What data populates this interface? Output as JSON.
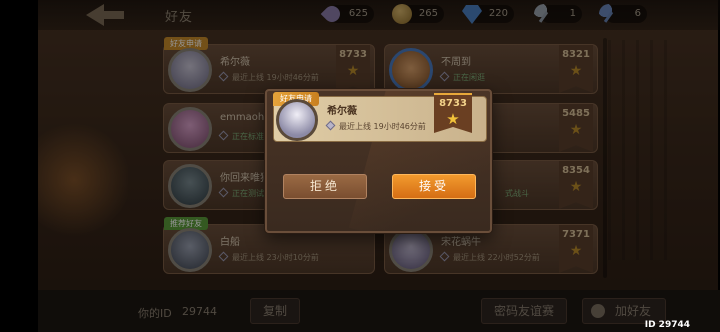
{
  "header": {
    "title": "好友",
    "resources": [
      {
        "icon": "feather-icon",
        "value": "625"
      },
      {
        "icon": "coin-icon",
        "value": "265"
      },
      {
        "icon": "gem-icon",
        "value": "220"
      },
      {
        "icon": "silver-key-icon",
        "value": "1"
      },
      {
        "icon": "blue-key-icon",
        "value": "6"
      }
    ]
  },
  "friends": [
    {
      "name": "希尔薇",
      "status": "最近上线 19小时46分前",
      "score": "8733",
      "tag": "好友申请"
    },
    {
      "name": "emmaoh",
      "status": "正在标准",
      "score": ""
    },
    {
      "name": "你回来唯猎",
      "status": "正在测试",
      "score": ""
    },
    {
      "name": "白船",
      "status": "最近上线 23小时10分前",
      "score": "",
      "tag": "推荐好友"
    },
    {
      "name": "不周到",
      "status": "正在闲逛",
      "score": "8321"
    },
    {
      "name": "",
      "status": "",
      "score": "5485"
    },
    {
      "name": "",
      "status": "式战斗",
      "score": "8354"
    },
    {
      "name": "宋花蜗牛",
      "status": "最近上线 22小时52分前",
      "score": "7371"
    }
  ],
  "footer": {
    "id_label": "你的ID",
    "id_value": "29744",
    "copy_label": "复制",
    "secret_label": "密码友谊赛",
    "add_friend_label": "加好友",
    "corner_id": "ID 29744"
  },
  "dialog": {
    "tag": "好友申请",
    "name": "希尔薇",
    "status": "最近上线 19小时46分前",
    "score": "8733",
    "reject_label": "拒绝",
    "accept_label": "接受"
  }
}
